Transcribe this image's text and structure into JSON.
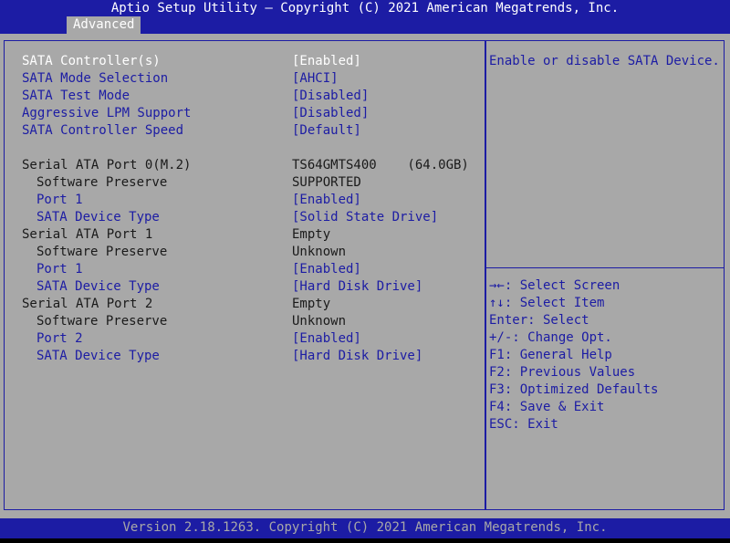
{
  "header": {
    "title": "Aptio Setup Utility – Copyright (C) 2021 American Megatrends, Inc.",
    "tab": "Advanced"
  },
  "settings": [
    {
      "label": "SATA Controller(s)",
      "value": "[Enabled]",
      "selected": true
    },
    {
      "label": "SATA Mode Selection",
      "value": "[AHCI]"
    },
    {
      "label": "SATA Test Mode",
      "value": "[Disabled]"
    },
    {
      "label": "Aggressive LPM Support",
      "value": "[Disabled]"
    },
    {
      "label": "SATA Controller Speed",
      "value": "[Default]"
    }
  ],
  "ports": [
    {
      "label": "Serial ATA Port 0(M.2)",
      "value": "TS64GMTS400    (64.0GB)"
    },
    {
      "label": "Software Preserve",
      "value": "SUPPORTED"
    },
    {
      "label": "Port 1",
      "value": "[Enabled]"
    },
    {
      "label": "SATA Device Type",
      "value": "[Solid State Drive]"
    },
    {
      "label": "Serial ATA Port 1",
      "value": "Empty"
    },
    {
      "label": "Software Preserve",
      "value": "Unknown"
    },
    {
      "label": "Port 1",
      "value": "[Enabled]"
    },
    {
      "label": "SATA Device Type",
      "value": "[Hard Disk Drive]"
    },
    {
      "label": "Serial ATA Port 2",
      "value": "Empty"
    },
    {
      "label": "Software Preserve",
      "value": "Unknown"
    },
    {
      "label": "Port 2",
      "value": "[Enabled]"
    },
    {
      "label": "SATA Device Type",
      "value": "[Hard Disk Drive]"
    }
  ],
  "help": {
    "text": "Enable or disable SATA Device."
  },
  "keys": [
    "→←: Select Screen",
    "↑↓: Select Item",
    "Enter: Select",
    "+/-: Change Opt.",
    "F1: General Help",
    "F2: Previous Values",
    "F3: Optimized Defaults",
    "F4: Save & Exit",
    "ESC: Exit"
  ],
  "footer": {
    "text": "Version 2.18.1263. Copyright (C) 2021 American Megatrends, Inc."
  },
  "colors": {
    "bar": "#1c1ca4",
    "background": "#a8a8a8",
    "selected_text": "#ffffff"
  }
}
